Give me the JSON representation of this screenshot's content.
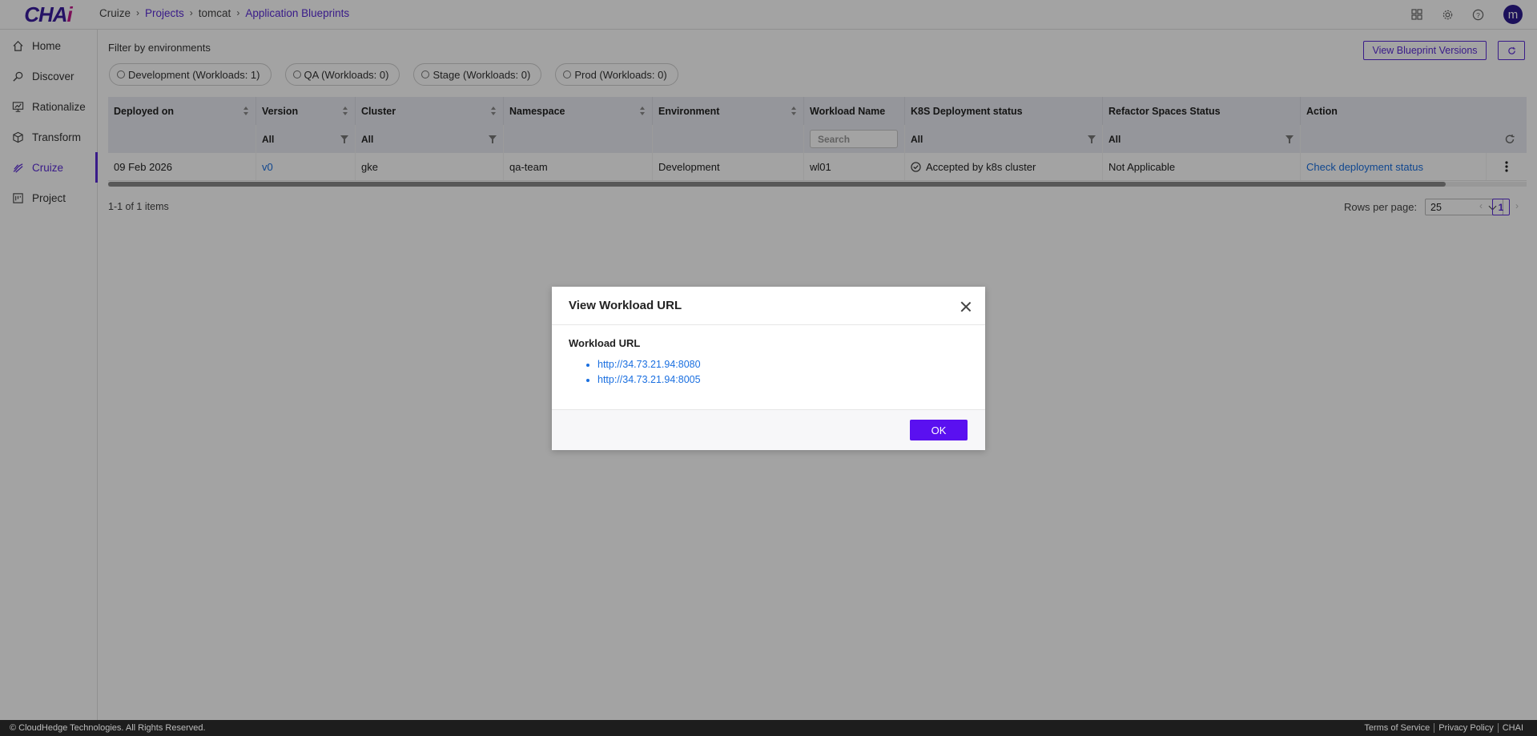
{
  "app": {
    "logo_text": "CHA",
    "logo_accent": "i"
  },
  "breadcrumb": [
    {
      "label": "Cruize",
      "link": false
    },
    {
      "label": "Projects",
      "link": true
    },
    {
      "label": "tomcat",
      "link": false
    },
    {
      "label": "Application Blueprints",
      "link": true
    }
  ],
  "topbar": {
    "avatar_initial": "m",
    "icons": [
      "apps-grid-icon",
      "gear-icon",
      "help-icon"
    ]
  },
  "sidebar": {
    "items": [
      {
        "label": "Home",
        "icon": "home-icon",
        "active": false
      },
      {
        "label": "Discover",
        "icon": "discover-icon",
        "active": false
      },
      {
        "label": "Rationalize",
        "icon": "rationalize-icon",
        "active": false
      },
      {
        "label": "Transform",
        "icon": "cube-icon",
        "active": false
      },
      {
        "label": "Cruize",
        "icon": "cruize-icon",
        "active": true
      },
      {
        "label": "Project",
        "icon": "project-icon",
        "active": false
      }
    ]
  },
  "filters": {
    "title": "Filter by environments",
    "chips": [
      "Development (Workloads: 1)",
      "QA (Workloads: 0)",
      "Stage (Workloads: 0)",
      "Prod (Workloads: 0)"
    ]
  },
  "actions": {
    "view_versions": "View Blueprint Versions"
  },
  "table": {
    "headers": [
      "Deployed on",
      "Version",
      "Cluster",
      "Namespace",
      "Environment",
      "Workload Name",
      "K8S Deployment status",
      "Refactor Spaces Status",
      "Action"
    ],
    "filters": {
      "version": "All",
      "cluster": "All",
      "workload_search_placeholder": "Search",
      "k8s_status": "All",
      "refactor_status": "All"
    },
    "rows": [
      {
        "deployed_on": "09 Feb 2026",
        "version": "v0",
        "cluster": "gke",
        "namespace": "qa-team",
        "environment": "Development",
        "workload_name": "wl01",
        "k8s_status": "Accepted by k8s cluster",
        "refactor_status": "Not Applicable",
        "action": "Check deployment status"
      }
    ]
  },
  "pagination": {
    "items_text": "1-1 of 1 items",
    "rows_per_page_label": "Rows per page:",
    "rows_per_page": "25",
    "current_page": "1",
    "prev": "‹",
    "next": "›"
  },
  "footer": {
    "copyright": "© CloudHedge Technologies. All Rights Reserved.",
    "links": [
      "Terms of Service",
      "Privacy Policy",
      "CHAI"
    ]
  },
  "modal": {
    "title": "View Workload URL",
    "label": "Workload URL",
    "urls": [
      "http://34.73.21.94:8080",
      "http://34.73.21.94:8005"
    ],
    "ok_label": "OK"
  },
  "colors": {
    "accent": "#5a2bd6",
    "button_primary": "#5a10f0",
    "link": "#1a6fe0",
    "footer_bg": "#1d1d1d"
  }
}
